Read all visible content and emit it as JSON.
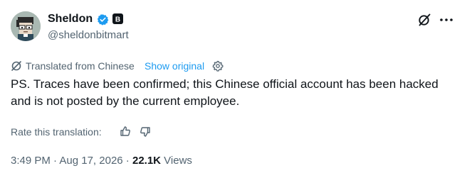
{
  "author": {
    "display_name": "Sheldon",
    "handle": "@sheldonbitmart",
    "avatar_icon": "pixel-avatar",
    "verified_icon": "verified-badge-icon",
    "affiliate_icon": "affiliate-badge-icon"
  },
  "header_actions": {
    "grok_icon": "grok-icon",
    "more_icon": "more-dots-icon"
  },
  "translation": {
    "label": "Translated from Chinese",
    "show_original": "Show original"
  },
  "body": {
    "text": "PS. Traces have been confirmed; this Chinese official account has been hacked and is not posted by the current employee."
  },
  "rating": {
    "label": "Rate this translation:"
  },
  "meta": {
    "time": "3:49 PM",
    "separator1": " · ",
    "date": "Aug 17, 2026",
    "separator2": " · ",
    "views_count": "22.1K",
    "views_label": " Views"
  },
  "colors": {
    "text": "#0f1419",
    "secondary": "#536471",
    "link": "#1d9bf0",
    "verified": "#1d9bf0"
  }
}
